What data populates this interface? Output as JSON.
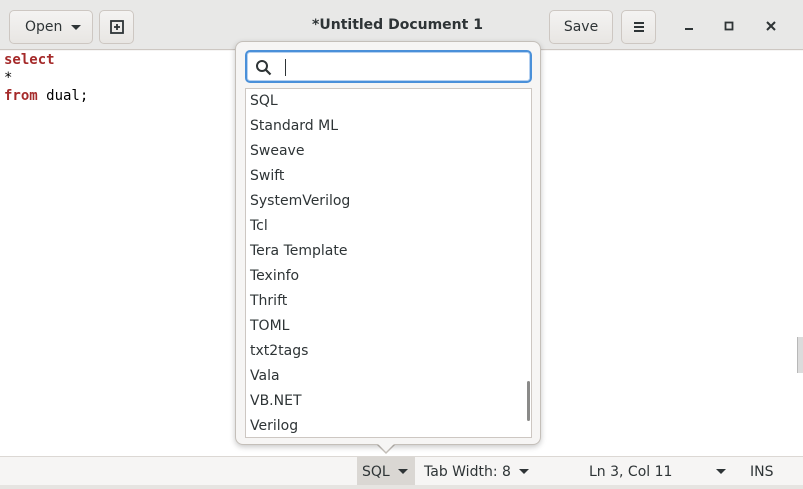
{
  "header": {
    "open_label": "Open",
    "title": "*Untitled Document 1",
    "save_label": "Save"
  },
  "editor": {
    "lines": [
      {
        "keyword": "select",
        "text": ""
      },
      {
        "keyword": "",
        "text": "*"
      },
      {
        "keyword": "from",
        "text": " dual;"
      }
    ]
  },
  "language_popover": {
    "search_value": "",
    "items": [
      "SQL",
      "Standard ML",
      "Sweave",
      "Swift",
      "SystemVerilog",
      "Tcl",
      "Tera Template",
      "Texinfo",
      "Thrift",
      "TOML",
      "txt2tags",
      "Vala",
      "VB.NET",
      "Verilog"
    ]
  },
  "statusbar": {
    "language": "SQL",
    "tab_width": "Tab Width: 8",
    "position": "Ln 3, Col 11",
    "mode": "INS"
  },
  "colors": {
    "keyword": "#a52a2a",
    "focus_ring": "#4a90d9"
  }
}
